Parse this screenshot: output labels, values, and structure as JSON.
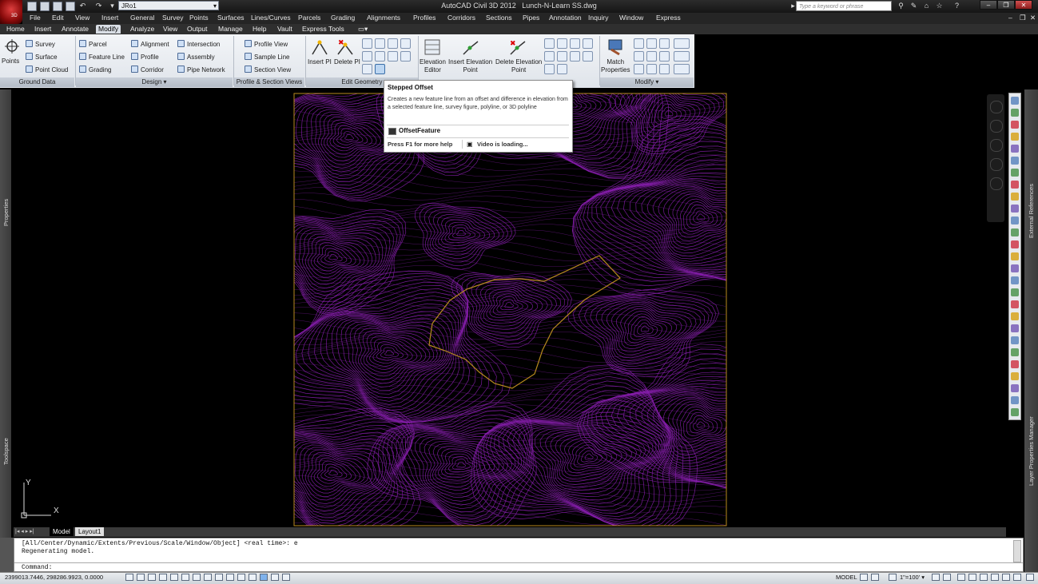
{
  "app": {
    "title": "AutoCAD Civil 3D 2012",
    "document": "Lunch-N-Learn SS.dwg",
    "app_button_badge": "3D",
    "workspace": "JRo1"
  },
  "search": {
    "placeholder": "Type a keyword or phrase"
  },
  "menu": [
    "File",
    "Edit",
    "View",
    "Insert",
    "General",
    "Survey",
    "Points",
    "Surfaces",
    "Lines/Curves",
    "Parcels",
    "Grading",
    "Alignments",
    "Profiles",
    "Corridors",
    "Sections",
    "Pipes",
    "Annotation",
    "Inquiry",
    "Window",
    "Express"
  ],
  "tabs": [
    "Home",
    "Insert",
    "Annotate",
    "Modify",
    "Analyze",
    "View",
    "Output",
    "Manage",
    "Help",
    "Vault",
    "Express Tools"
  ],
  "active_tab": "Modify",
  "ribbon": {
    "ground_data": {
      "title": "Ground Data",
      "points": "Points",
      "items": [
        "Survey",
        "Surface",
        "Point Cloud"
      ]
    },
    "design": {
      "title": "Design",
      "col1": [
        "Parcel",
        "Feature Line",
        "Grading"
      ],
      "col2": [
        "Alignment",
        "Profile",
        "Corridor"
      ],
      "col3": [
        "Intersection",
        "Assembly",
        "Pipe Network"
      ]
    },
    "profile_section": {
      "title": "Profile & Section Views",
      "items": [
        "Profile View",
        "Sample Line",
        "Section View"
      ]
    },
    "edit_geometry": {
      "title": "Edit Geometry",
      "insert_pi": "Insert PI",
      "delete_pi": "Delete PI"
    },
    "edit_elevations": {
      "elevation_editor": [
        "Elevation",
        "Editor"
      ],
      "insert_elevation_point": [
        "Insert Elevation",
        "Point"
      ],
      "delete_elevation_point": [
        "Delete Elevation",
        "Point"
      ]
    },
    "modify": {
      "title": "Modify",
      "match_properties": [
        "Match",
        "Properties"
      ]
    }
  },
  "tooltip": {
    "title": "Stepped Offset",
    "description": "Creates a new feature line from an offset and difference in elevation from a selected feature line, survey figure, polyline, or 3D polyline",
    "command": "OffsetFeature",
    "help": "Press F1 for more help",
    "video": "Video is loading..."
  },
  "palettes": {
    "left_top": "Properties",
    "left_bottom": "Toolspace",
    "right_top": "External References",
    "right_bottom": "Layer Properties Manager"
  },
  "ucs": {
    "x": "X",
    "y": "Y"
  },
  "layout_tabs": [
    "Model",
    "Layout1"
  ],
  "command_history": [
    "[All/Center/Dynamic/Extents/Previous/Scale/Window/Object] <real time>: e",
    "Regenerating model."
  ],
  "command_prompt": "Command:",
  "status": {
    "coordinates": "2399013.7446, 298286.9923, 0.0000",
    "space": "MODEL",
    "annotation_scale": "1\"=100'"
  },
  "colors": {
    "contours": "#8a1fb0",
    "boundary": "#b88a1e",
    "background": "#000000"
  }
}
